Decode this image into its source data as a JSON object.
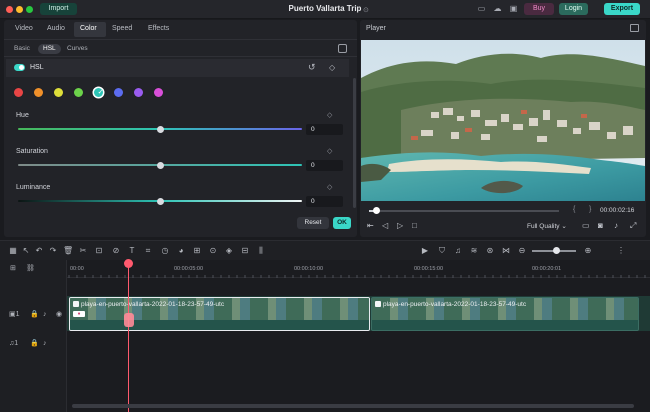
{
  "titlebar": {
    "import_label": "Import",
    "project_title": "Puerto Vallarta Trip",
    "buy_label": "Buy",
    "login_label": "Login",
    "export_label": "Export",
    "icons": [
      "monitor-icon",
      "cloud-upload-icon",
      "gift-icon",
      "cart-icon"
    ]
  },
  "panel": {
    "tabs": [
      "Video",
      "Audio",
      "Color",
      "Speed",
      "Effects"
    ],
    "active_tab": "Color",
    "subtabs": [
      "Basic",
      "HSL",
      "Curves"
    ],
    "active_subtab": "HSL",
    "section_label": "HSL",
    "swatch_colors": [
      "#e84545",
      "#f0902a",
      "#dede3a",
      "#6cd24a",
      "#2ec4b6",
      "#5c6cf0",
      "#9a5cf0",
      "#d94fd9"
    ],
    "selected_swatch": 4,
    "sliders": [
      {
        "label": "Hue",
        "value": "0",
        "level": 0.5
      },
      {
        "label": "Saturation",
        "value": "0",
        "level": 0.5
      },
      {
        "label": "Luminance",
        "value": "0",
        "level": 0.5
      }
    ],
    "reset_label": "Reset",
    "ok_label": "OK"
  },
  "player": {
    "title": "Player",
    "timecode": "00:00:02:16",
    "progress": 0.04,
    "quality": "Full Quality"
  },
  "timeline": {
    "ruler_labels": [
      "00:00",
      "00:00:05:00",
      "00:00:10:00",
      "00:00:15:00",
      "00:00:20:01"
    ],
    "clips": [
      {
        "name": "playa-en-puerto-vallarta-2022-01-18-23-57-49-utc"
      },
      {
        "name": "playa-en-puerto-vallarta-2022-01-18-23-57-49-utc"
      }
    ],
    "video_track_label": "1",
    "audio_track_label": "1"
  }
}
